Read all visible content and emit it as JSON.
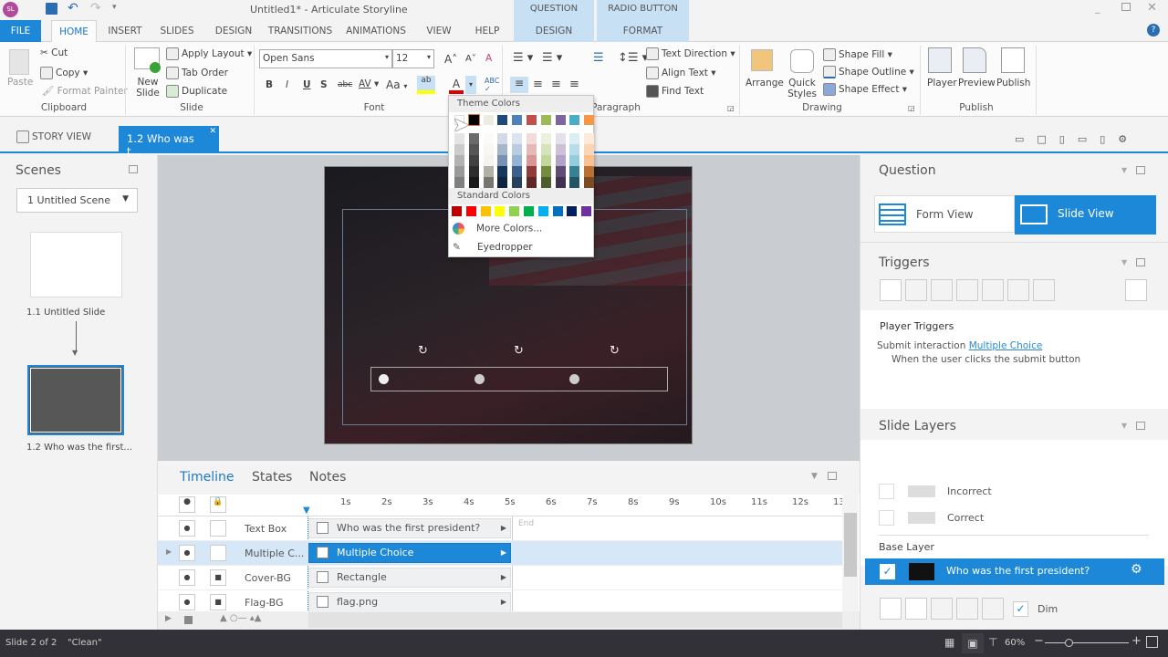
{
  "title_bar": {
    "app_badge": "SL",
    "title": "Untitled1* - Articulate Storyline",
    "context_groups": [
      "QUESTION TOOLS",
      "RADIO BUTTON"
    ]
  },
  "tabs": [
    "FILE",
    "HOME",
    "INSERT",
    "SLIDES",
    "DESIGN",
    "TRANSITIONS",
    "ANIMATIONS",
    "VIEW",
    "HELP",
    "DESIGN",
    "FORMAT"
  ],
  "active_tab": "HOME",
  "ribbon": {
    "clipboard": {
      "paste": "Paste",
      "cut": "Cut",
      "copy": "Copy",
      "format_painter": "Format Painter",
      "label": "Clipboard"
    },
    "slide": {
      "new_slide": "New Slide",
      "apply_layout": "Apply Layout",
      "tab_order": "Tab Order",
      "duplicate": "Duplicate",
      "label": "Slide"
    },
    "font": {
      "font_name": "Open Sans",
      "font_size": "12",
      "bold": "B",
      "italic": "I",
      "underline": "U",
      "shadow": "S",
      "strike": "abc",
      "spacing": "AV",
      "case": "Aa",
      "label": "Font"
    },
    "paragraph": {
      "text_direction": "Text Direction",
      "align_text": "Align Text",
      "find_text": "Find Text",
      "label": "Paragraph"
    },
    "drawing": {
      "arrange": "Arrange",
      "quick_styles": "Quick Styles",
      "shape_fill": "Shape Fill",
      "shape_outline": "Shape Outline",
      "shape_effect": "Shape Effect",
      "label": "Drawing"
    },
    "publish": {
      "player": "Player",
      "preview": "Preview",
      "publish": "Publish",
      "label": "Publish"
    }
  },
  "color_picker": {
    "theme_label": "Theme Colors",
    "theme_colors": [
      "#ffffff",
      "#000000",
      "#eeece1",
      "#1f497d",
      "#4f81bd",
      "#c0504d",
      "#9bbb59",
      "#8064a2",
      "#4bacc6",
      "#f79646"
    ],
    "standard_label": "Standard Colors",
    "standard_colors": [
      "#c00000",
      "#ff0000",
      "#ffc000",
      "#ffff00",
      "#92d050",
      "#00b050",
      "#00b0f0",
      "#0070c0",
      "#002060",
      "#7030a0"
    ],
    "more_colors": "More Colors...",
    "eyedropper": "Eyedropper"
  },
  "doc_tabs": {
    "story_view": "STORY VIEW",
    "current": "1.2 Who was t..."
  },
  "scenes": {
    "header": "Scenes",
    "scene_select": "1 Untitled Scene",
    "slides": [
      {
        "label": "1.1 Untitled Slide"
      },
      {
        "label": "1.2 Who was the first..."
      }
    ]
  },
  "timeline": {
    "tabs": [
      "Timeline",
      "States",
      "Notes"
    ],
    "ticks": [
      "1s",
      "2s",
      "3s",
      "4s",
      "5s",
      "6s",
      "7s",
      "8s",
      "9s",
      "10s",
      "11s",
      "12s",
      "13"
    ],
    "end_label": "End",
    "rows": [
      {
        "name": "Text Box",
        "bar": "Who was the first president?",
        "locked": false,
        "selected": false
      },
      {
        "name": "Multiple C...",
        "bar": "Multiple Choice",
        "locked": false,
        "selected": true
      },
      {
        "name": "Cover-BG",
        "bar": "Rectangle",
        "locked": true,
        "selected": false
      },
      {
        "name": "Flag-BG",
        "bar": "flag.png",
        "locked": true,
        "selected": false
      }
    ]
  },
  "question": {
    "header": "Question",
    "form_view": "Form View",
    "slide_view": "Slide View"
  },
  "triggers": {
    "header": "Triggers",
    "player_triggers": "Player Triggers",
    "trigger_action": "Submit interaction",
    "trigger_target": "Multiple Choice",
    "trigger_when": "When the user clicks the submit button"
  },
  "layers": {
    "header": "Slide Layers",
    "items": [
      "Incorrect",
      "Correct"
    ],
    "base_label": "Base Layer",
    "base_name": "Who was the first president?",
    "dim": "Dim",
    "dim_checked": true
  },
  "status": {
    "slide": "Slide 2 of 2",
    "theme": "\"Clean\"",
    "zoom": "60%"
  },
  "colors": {
    "accent": "#1e88d8",
    "status_bg": "#323138"
  }
}
